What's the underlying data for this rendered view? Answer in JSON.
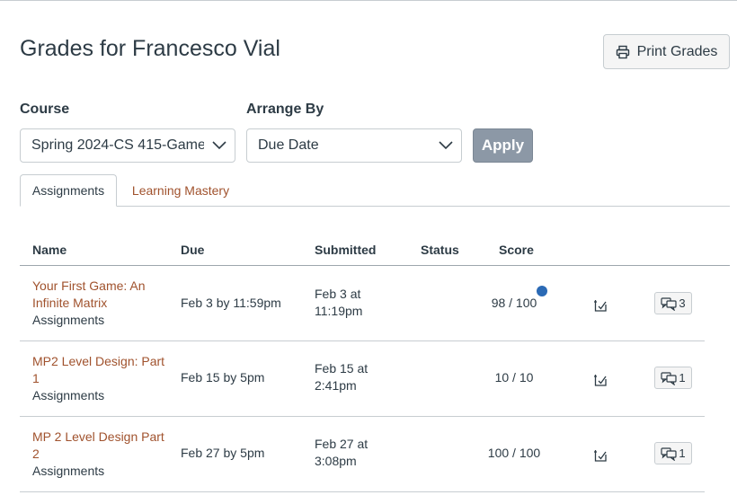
{
  "page": {
    "title": "Grades for Francesco Vial"
  },
  "toolbar": {
    "print_label": "Print Grades",
    "print_icon": "printer-icon"
  },
  "filters": {
    "course_label": "Course",
    "course_value": "Spring 2024-CS 415-Game",
    "arrange_label": "Arrange By",
    "arrange_value": "Due Date",
    "apply_label": "Apply"
  },
  "tabs": [
    {
      "label": "Assignments",
      "active": true
    },
    {
      "label": "Learning Mastery",
      "active": false
    }
  ],
  "table": {
    "headers": {
      "name": "Name",
      "due": "Due",
      "submitted": "Submitted",
      "status": "Status",
      "score": "Score"
    },
    "rows": [
      {
        "name": "Your First Game: An Infinite Matrix",
        "group": "Assignments",
        "due": "Feb 3 by 11:59pm",
        "submitted": "Feb 3 at 11:19pm",
        "status": "",
        "score": "98 / 100",
        "unread": true,
        "comments": "3"
      },
      {
        "name": "MP2 Level Design: Part 1",
        "group": "Assignments",
        "due": "Feb 15 by 5pm",
        "submitted": "Feb 15 at 2:41pm",
        "status": "",
        "score": "10 / 10",
        "unread": false,
        "comments": "1"
      },
      {
        "name": "MP 2 Level Design Part 2",
        "group": "Assignments",
        "due": "Feb 27 by 5pm",
        "submitted": "Feb 27 at 3:08pm",
        "status": "",
        "score": "100 / 100",
        "unread": false,
        "comments": "1"
      }
    ]
  },
  "colors": {
    "link": "#a0522d",
    "accent": "#2b6ab5",
    "apply_bg": "#8c98a6"
  }
}
